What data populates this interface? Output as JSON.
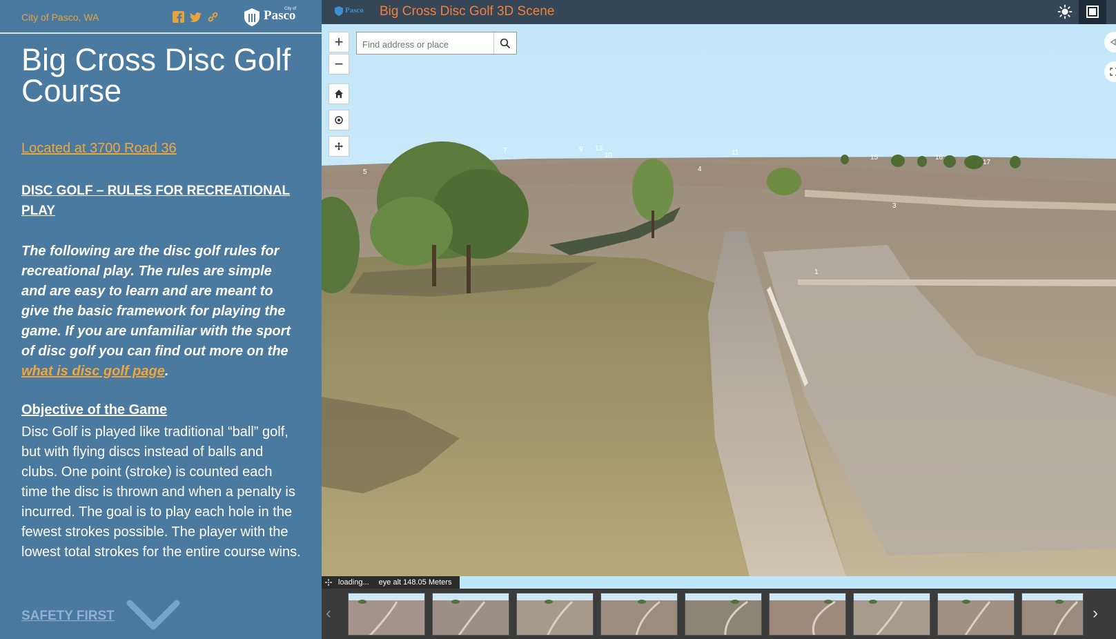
{
  "panel": {
    "city_name": "City of Pasco, WA",
    "logo_small": "City of",
    "logo_text": "Pasco",
    "share_icons": [
      "facebook-icon",
      "twitter-icon",
      "link-icon"
    ],
    "title": "Big Cross Disc Golf Course",
    "location_link": "Located at 3700 Road 36",
    "rules_heading": "DISC GOLF – RULES FOR RECREATIONAL PLAY",
    "intro_text": "The following are the disc golf rules for recreational play. The rules are simple and are easy to learn and are meant to give the basic framework for playing the game. If you are unfamiliar with the sport of disc golf you can find out more on the ",
    "intro_link": "what is disc golf page",
    "intro_end": ".",
    "objective_heading": "Objective of the Game",
    "objective_text": "Disc Golf is played like traditional “ball” golf, but with flying discs instead of balls and clubs. One point (stroke) is counted each time the disc is thrown and when a penalty is incurred. The goal is to play each hole in the fewest strokes possible. The player with the lowest total strokes for the entire course wins.",
    "next_section": "SAFETY FIRST"
  },
  "scene": {
    "topbar_logo": "Pasco",
    "title": "Big Cross Disc Golf 3D Scene",
    "search_placeholder": "Find address or place",
    "zoom_in": "+",
    "zoom_out": "−",
    "status_loading": "loading...",
    "status_alt": "eye alt 148.05 Meters",
    "hole_labels": [
      "5",
      "7",
      "9",
      "13",
      "10",
      "11",
      "4",
      "15",
      "16",
      "17",
      "3",
      "1"
    ],
    "thumbnail_count": 9,
    "prev_arrow": "‹",
    "next_arrow": "›"
  },
  "colors": {
    "panel_bg": "#4a7aa0",
    "accent_orange": "#f0a53a",
    "topbar_bg": "#354657",
    "title_orange": "#f0803a"
  }
}
